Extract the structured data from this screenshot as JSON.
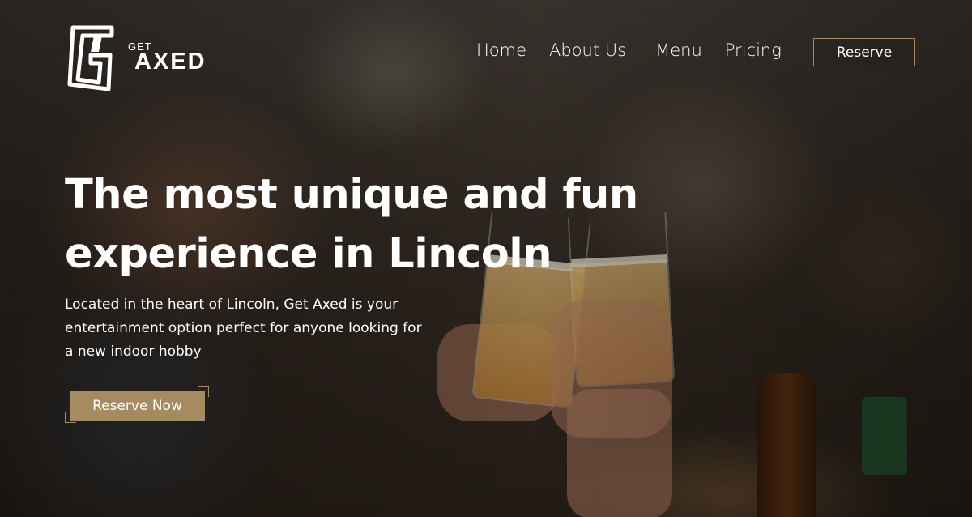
{
  "brand": {
    "logo_mark": "GA",
    "logo_small": "GET",
    "logo_large": "AXED",
    "accent_color": "#a58a62"
  },
  "nav": {
    "items": [
      {
        "label": "Home"
      },
      {
        "label": "About Us"
      },
      {
        "label": "Menu"
      },
      {
        "label": "Pricing"
      }
    ],
    "reserve_label": "Reserve"
  },
  "hero": {
    "headline_line1": "The most unique and fun",
    "headline_line2": "experience in Lincoln",
    "subtext_line1": "Located in the heart of Lincoln, Get Axed is your",
    "subtext_line2": "entertainment option perfect for anyone looking for",
    "subtext_line3": "a new indoor hobby",
    "cta_label": "Reserve Now"
  }
}
